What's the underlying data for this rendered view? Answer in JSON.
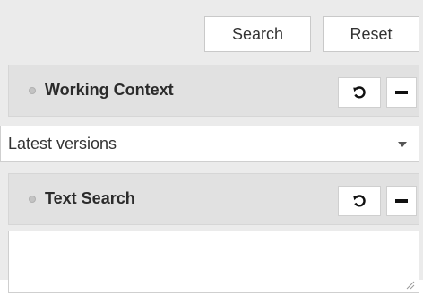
{
  "toolbar": {
    "search_label": "Search",
    "reset_label": "Reset"
  },
  "sections": [
    {
      "title": "Working Context",
      "reset_icon": "rotate-ccw-icon",
      "collapse_icon": "minus-icon"
    },
    {
      "title": "Text Search",
      "reset_icon": "rotate-ccw-icon",
      "collapse_icon": "minus-icon"
    }
  ],
  "working_context": {
    "selected": "Latest versions"
  },
  "text_search": {
    "value": ""
  },
  "colors": {
    "panel_bg": "#ebebeb",
    "header_bg": "#e1e1e1",
    "border": "#cfcfcf"
  }
}
